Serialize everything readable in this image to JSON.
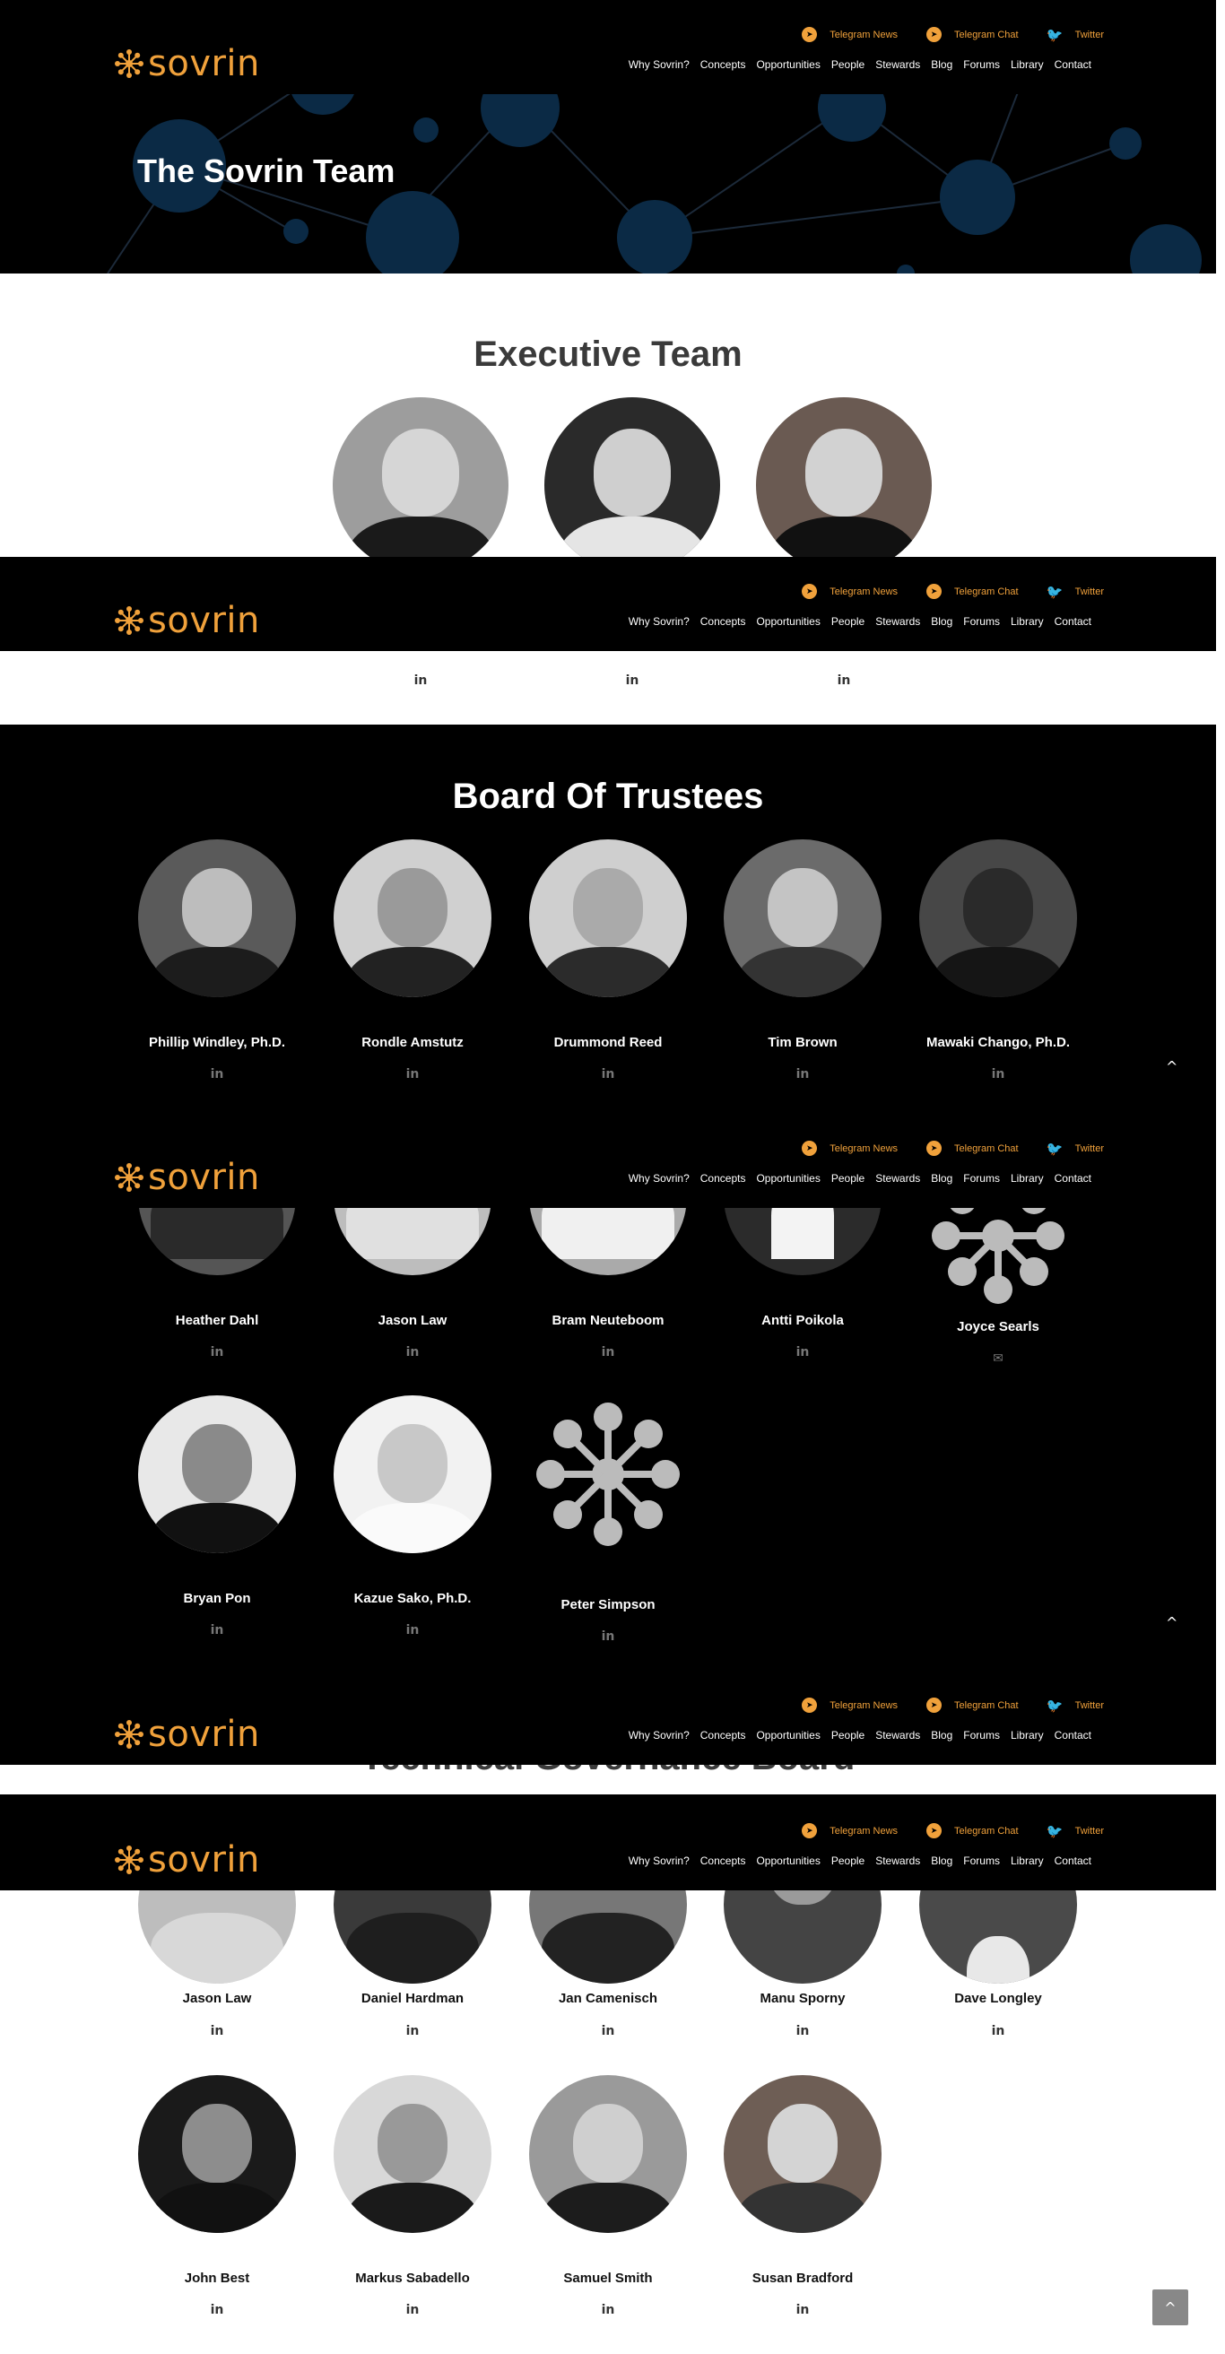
{
  "header": {
    "logo_text": "sovrin",
    "social": [
      {
        "label": "Telegram News",
        "icon": "telegram-icon"
      },
      {
        "label": "Telegram Chat",
        "icon": "telegram-icon"
      },
      {
        "label": "Twitter",
        "icon": "twitter-icon"
      }
    ],
    "nav": [
      "Why Sovrin?",
      "Concepts",
      "Opportunities",
      "People",
      "Stewards",
      "Blog",
      "Forums",
      "Library",
      "Contact"
    ]
  },
  "hero": {
    "title": "The Sovrin Team"
  },
  "executive": {
    "title": "Executive Team"
  },
  "board": {
    "title": "Board Of Trustees",
    "row1": [
      "Phillip Windley, Ph.D.",
      "Rondle Amstutz",
      "Drummond Reed",
      "Tim Brown",
      "Mawaki Chango, Ph.D."
    ],
    "row2": [
      "Heather Dahl",
      "Jason Law",
      "Bram Neuteboom",
      "Antti Poikola",
      "Joyce Searls"
    ],
    "row3": [
      "Bryan Pon",
      "Kazue Sako, Ph.D.",
      "Peter Simpson"
    ]
  },
  "tgb": {
    "title_partial": "Technical Governance Board",
    "row1": [
      "Jason Law",
      "Daniel Hardman",
      "Jan Camenisch",
      "Manu Sporny",
      "Dave Longley"
    ],
    "row2": [
      "John Best",
      "Markus Sabadello",
      "Samuel Smith",
      "Susan Bradford"
    ]
  },
  "icons": {
    "linkedin": "in",
    "envelope": "✉",
    "up": "^"
  },
  "colors": {
    "accent": "#f0a13b",
    "hero_node": "#0b2a45"
  }
}
